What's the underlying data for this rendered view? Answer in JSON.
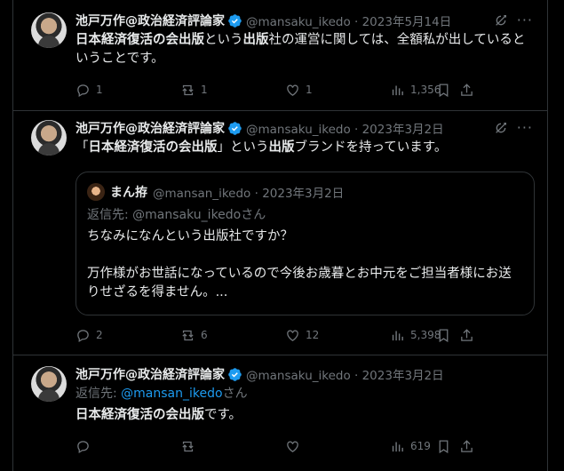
{
  "tweets": [
    {
      "name": "池戸万作@政治経済評論家",
      "handle": "@mansaku_ikedo · 2023年5月14日",
      "text_bold1": "日本経済復活の会出版",
      "text_plain1": "という",
      "text_bold2": "出版",
      "text_plain2": "社の運営に関しては、全額私が出しているということです。",
      "replies": "1",
      "reposts": "1",
      "likes": "1",
      "views": "1,356"
    },
    {
      "name": "池戸万作@政治経済評論家",
      "handle": "@mansaku_ikedo · 2023年3月2日",
      "text_plain0": "「",
      "text_bold1": "日本経済復活の会出版",
      "text_plain1": "」という",
      "text_bold2": "出版",
      "text_plain2": "ブランドを持っています。",
      "quote": {
        "name": "まん拵",
        "handle": "@mansan_ikedo · 2023年3月2日",
        "reply_to": "返信先: @mansaku_ikedoさん",
        "text1": "ちなみになんという出版社ですか？",
        "text2": "万作様がお世話になっているので今後お歳暮とお中元をご担当者様にお送りせざるを得ません。..."
      },
      "replies": "2",
      "reposts": "6",
      "likes": "12",
      "views": "5,398"
    },
    {
      "name": "池戸万作@政治経済評論家",
      "handle": "@mansaku_ikedo · 2023年3月2日",
      "reply_prefix": "返信先: ",
      "reply_link": "@mansan_ikedo",
      "reply_suffix": "さん",
      "text_bold1": "日本経済復活の会出版",
      "text_plain1": "です。",
      "views": "619"
    }
  ],
  "icons": [
    "verified-badge-icon",
    "grok-icon",
    "more-icon",
    "reply-icon",
    "repost-icon",
    "like-icon",
    "views-icon",
    "bookmark-icon",
    "share-icon"
  ],
  "colors": {
    "background": "#000000",
    "text": "#e7e9ea",
    "muted": "#71767b",
    "link": "#1d9bf0",
    "border": "#2f3336",
    "verified": "#1d9bf0"
  }
}
